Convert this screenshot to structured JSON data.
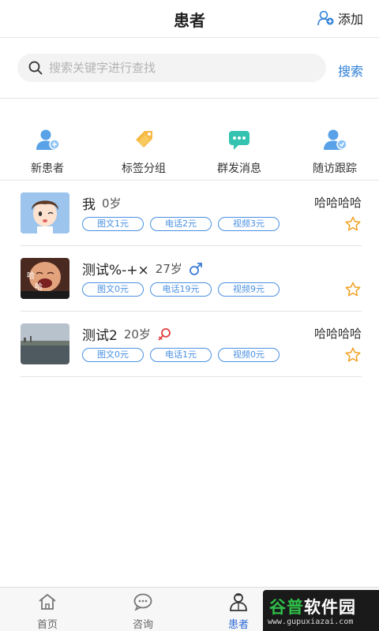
{
  "header": {
    "title": "患者",
    "add_label": "添加"
  },
  "search": {
    "placeholder": "搜索关键字进行查找",
    "button_label": "搜索"
  },
  "quick_actions": [
    {
      "label": "新患者",
      "icon": "user-add-icon"
    },
    {
      "label": "标签分组",
      "icon": "tag-icon"
    },
    {
      "label": "群发消息",
      "icon": "chat-bubble-icon"
    },
    {
      "label": "随访跟踪",
      "icon": "user-follow-icon"
    }
  ],
  "patients": [
    {
      "name": "我",
      "age": "0岁",
      "gender": "",
      "note": "哈哈哈哈",
      "tags": [
        "图文1元",
        "电话2元",
        "视频3元"
      ]
    },
    {
      "name": "测试%-+×",
      "age": "27岁",
      "gender": "male",
      "note": "",
      "avatar_text_1": "哈",
      "avatar_text_2": "哈",
      "tags": [
        "图文0元",
        "电话19元",
        "视频9元"
      ]
    },
    {
      "name": "测试2",
      "age": "20岁",
      "gender": "female",
      "note": "哈哈哈哈",
      "tags": [
        "图文0元",
        "电话1元",
        "视频0元"
      ]
    }
  ],
  "tabbar": [
    {
      "label": "首页",
      "icon": "home-icon",
      "active": false
    },
    {
      "label": "咨询",
      "icon": "chat-icon",
      "active": false
    },
    {
      "label": "患者",
      "icon": "doctor-icon",
      "active": true
    }
  ],
  "watermark": {
    "main_a": "谷普",
    "main_b": "软件园",
    "sub": "www.gupuxiazai.com"
  },
  "colors": {
    "accent": "#2f7fd8",
    "tag_blue": "#4a90e2",
    "star": "#f0a020",
    "male": "#3a7bd5",
    "female": "#e04040"
  }
}
